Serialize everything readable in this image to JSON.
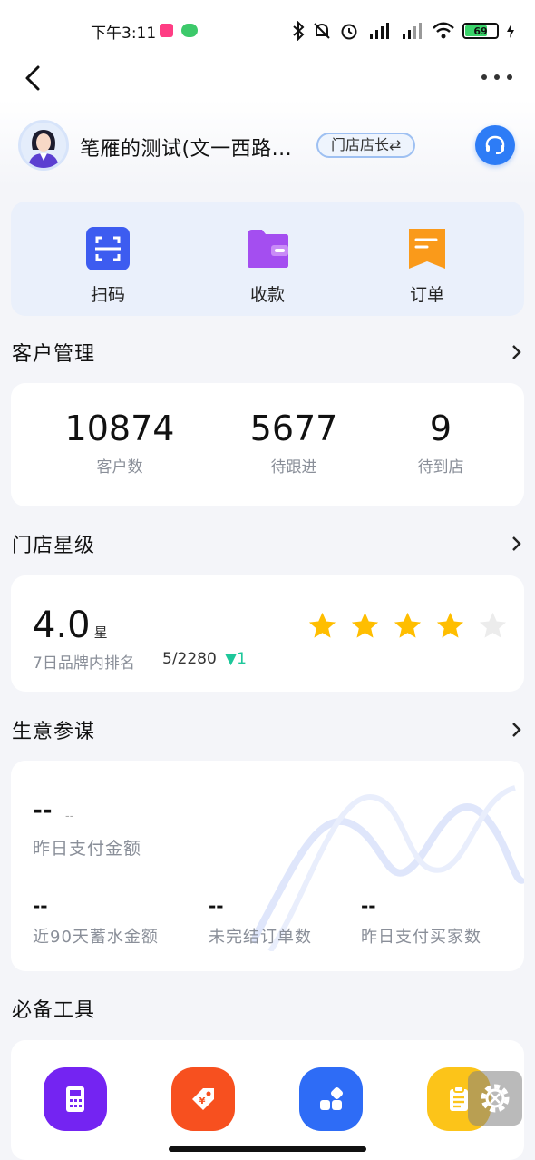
{
  "status_bar": {
    "time": "下午3:11",
    "battery_level": "69",
    "icons": [
      "bluetooth-icon",
      "mute-icon",
      "alarm-icon",
      "hd-signal-icon",
      "hd-signal-icon",
      "wifi-icon",
      "battery-icon",
      "charging-icon"
    ]
  },
  "header": {
    "store_name": "笔雁的测试(文一西路...",
    "role_badge": "门店店长⇄"
  },
  "quick_actions": [
    {
      "label": "扫码",
      "icon": "scan-icon",
      "color": "#3d5cf0"
    },
    {
      "label": "收款",
      "icon": "wallet-icon",
      "color": "#a44ef0"
    },
    {
      "label": "订单",
      "icon": "order-icon",
      "color": "#fa9a1a"
    }
  ],
  "customer_management": {
    "title": "客户管理",
    "stats": [
      {
        "value": "10874",
        "label": "客户数"
      },
      {
        "value": "5677",
        "label": "待跟进"
      },
      {
        "value": "9",
        "label": "待到店"
      }
    ]
  },
  "store_rating": {
    "title": "门店星级",
    "rating": "4.0",
    "unit": "星",
    "rank_label": "7日品牌内排名",
    "rank_value": "5/2280",
    "rank_change": "▼1",
    "stars_filled": 4,
    "stars_total": 5,
    "star_color": "#ffbe00"
  },
  "business_advisor": {
    "title": "生意参谋",
    "main_value": "--",
    "main_sub": "--",
    "main_label": "昨日支付金额",
    "metrics": [
      {
        "value": "--",
        "label": "近90天蓄水金额"
      },
      {
        "value": "--",
        "label": "未完结订单数"
      },
      {
        "value": "--",
        "label": "昨日支付买家数"
      }
    ]
  },
  "essential_tools": {
    "title": "必备工具",
    "tools": [
      {
        "icon": "pos-terminal-icon",
        "color": "#7424f2"
      },
      {
        "icon": "coupon-tag-icon",
        "color": "#f7501f"
      },
      {
        "icon": "apps-grid-icon",
        "color": "#2e6cf6"
      },
      {
        "icon": "clipboard-icon",
        "color": "#fcc419"
      }
    ]
  }
}
